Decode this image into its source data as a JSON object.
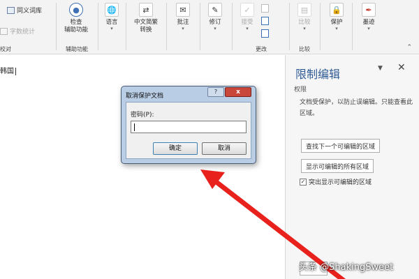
{
  "ribbon": {
    "proofing": {
      "thesaurus": "同义词库",
      "word_count": "字数统计",
      "group_label": "校对"
    },
    "accessibility": {
      "check_line1": "检查",
      "check_line2": "辅助功能",
      "group_label": "辅助功能"
    },
    "language": {
      "label": "语言"
    },
    "chinese_conversion": {
      "line1": "中文简繁",
      "line2": "转换"
    },
    "comments": {
      "label": "批注"
    },
    "tracking": {
      "label": "修订"
    },
    "changes": {
      "accept_label": "接受",
      "group_label": "更改"
    },
    "compare": {
      "label": "比较",
      "group_label": "比较"
    },
    "protect": {
      "label": "保护"
    },
    "ink": {
      "label": "墨迹"
    }
  },
  "document": {
    "text": "韩国"
  },
  "pane": {
    "title": "限制编辑",
    "section": "权限",
    "description": "文档受保护，以防止误编辑。只能查看此区域。",
    "find_next_button": "查找下一个可编辑的区域",
    "show_all_button": "显示可编辑的所有区域",
    "highlight_checkbox_label": "突出显示可编辑的区域",
    "highlight_checked": true
  },
  "dialog": {
    "title": "取消保护文档",
    "help": "?",
    "close": "x",
    "password_label": "密码(P):",
    "password_value": "",
    "ok_button": "确定",
    "cancel_button": "取消"
  },
  "watermark": "头条 @ShakingSweet",
  "colors": {
    "pane_title": "#2e5b95",
    "arrow": "#e8211c",
    "dialog_frame": "#b9cde5",
    "close_button": "#c8463a"
  },
  "icons": [
    "thesaurus-icon",
    "word-count-icon",
    "accessibility-check-icon",
    "language-icon",
    "chinese-conversion-icon",
    "comment-icon",
    "track-changes-icon",
    "accept-icon",
    "reject-icon",
    "previous-change-icon",
    "next-change-icon",
    "compare-icon",
    "protect-icon",
    "ink-icon",
    "close-icon",
    "help-icon"
  ]
}
